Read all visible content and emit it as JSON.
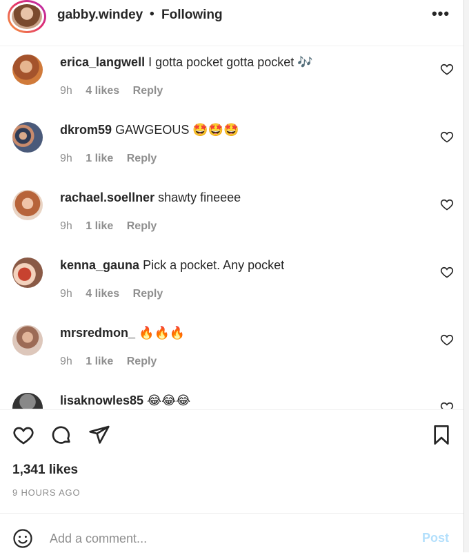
{
  "header": {
    "username": "gabby.windey",
    "separator": "•",
    "follow_status": "Following",
    "more_icon": "more-horizontal-icon"
  },
  "comments": [
    {
      "username": "erica_langwell",
      "text": "I gotta pocket gotta pocket 🎶",
      "time": "9h",
      "likes": "4 likes",
      "reply": "Reply"
    },
    {
      "username": "dkrom59",
      "text": "GAWGEOUS 🤩🤩🤩",
      "time": "9h",
      "likes": "1 like",
      "reply": "Reply"
    },
    {
      "username": "rachael.soellner",
      "text": "shawty fineeee",
      "time": "9h",
      "likes": "1 like",
      "reply": "Reply"
    },
    {
      "username": "kenna_gauna",
      "text": "Pick a pocket. Any pocket",
      "time": "9h",
      "likes": "4 likes",
      "reply": "Reply"
    },
    {
      "username": "mrsredmon_",
      "text": "🔥🔥🔥",
      "time": "9h",
      "likes": "1 like",
      "reply": "Reply"
    },
    {
      "username": "lisaknowles85",
      "text": "😂😂😂",
      "time": "",
      "likes": "",
      "reply": ""
    }
  ],
  "actions": {
    "like_icon": "heart-icon",
    "comment_icon": "comment-bubble-icon",
    "share_icon": "paper-plane-icon",
    "save_icon": "bookmark-icon",
    "likes_count": "1,341 likes",
    "posted_ago": "9 HOURS AGO"
  },
  "add_comment": {
    "emoji_icon": "smiley-icon",
    "placeholder": "Add a comment...",
    "post_label": "Post"
  },
  "colors": {
    "text": "#262626",
    "secondary": "#8e8e8e",
    "post_disabled": "#b2dffc",
    "divider": "#efefef"
  }
}
